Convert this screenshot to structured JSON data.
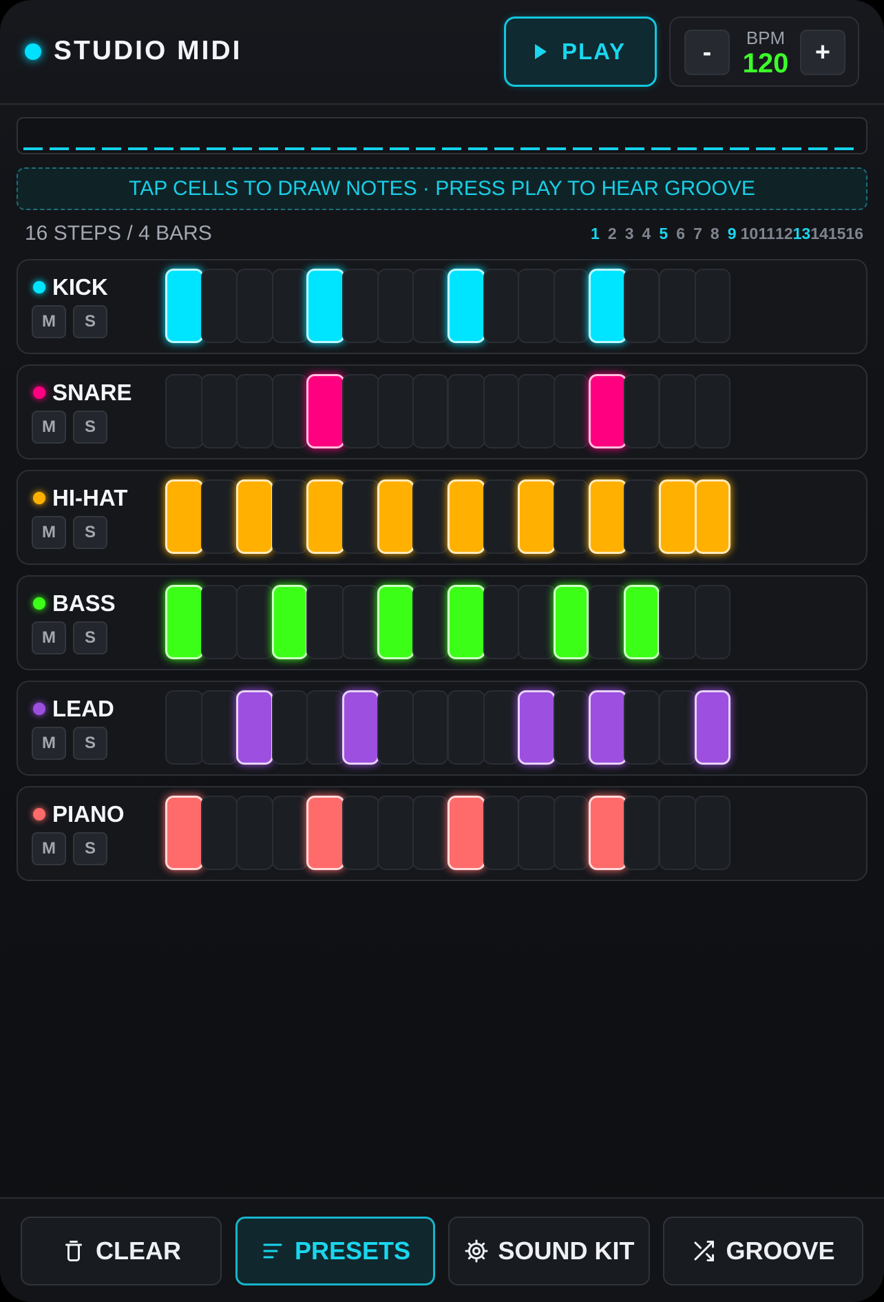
{
  "header": {
    "title": "STUDIO MIDI",
    "play_label": "PLAY",
    "bpm_label": "BPM",
    "bpm_value": "120",
    "bpm_minus": "-",
    "bpm_plus": "+"
  },
  "hint": "TAP CELLS TO DRAW NOTES · PRESS PLAY TO HEAR GROOVE",
  "steps_label": "16 STEPS / 4 BARS",
  "step_numbers": [
    "1",
    "2",
    "3",
    "4",
    "5",
    "6",
    "7",
    "8",
    "9",
    "10",
    "11",
    "12",
    "13",
    "14",
    "15",
    "16"
  ],
  "highlighted_steps": [
    1,
    5,
    9,
    13
  ],
  "mute_label": "M",
  "solo_label": "S",
  "tracks": [
    {
      "name": "KICK",
      "color": "#00e5ff",
      "pattern": [
        1,
        0,
        0,
        0,
        1,
        0,
        0,
        0,
        1,
        0,
        0,
        0,
        1,
        0,
        0,
        0
      ]
    },
    {
      "name": "SNARE",
      "color": "#ff0080",
      "pattern": [
        0,
        0,
        0,
        0,
        1,
        0,
        0,
        0,
        0,
        0,
        0,
        0,
        1,
        0,
        0,
        0
      ]
    },
    {
      "name": "HI-HAT",
      "color": "#ffb000",
      "pattern": [
        1,
        0,
        1,
        0,
        1,
        0,
        1,
        0,
        1,
        0,
        1,
        0,
        1,
        0,
        1,
        1
      ]
    },
    {
      "name": "BASS",
      "color": "#3cff18",
      "pattern": [
        1,
        0,
        0,
        1,
        0,
        0,
        1,
        0,
        1,
        0,
        0,
        1,
        0,
        1,
        0,
        0
      ]
    },
    {
      "name": "LEAD",
      "color": "#9d4fe0",
      "pattern": [
        0,
        0,
        1,
        0,
        0,
        1,
        0,
        0,
        0,
        0,
        1,
        0,
        1,
        0,
        0,
        1
      ]
    },
    {
      "name": "PIANO",
      "color": "#ff6b6b",
      "pattern": [
        1,
        0,
        0,
        0,
        1,
        0,
        0,
        0,
        1,
        0,
        0,
        0,
        1,
        0,
        0,
        0
      ]
    }
  ],
  "bottom_bar": {
    "clear": "CLEAR",
    "presets": "PRESETS",
    "sound_kit": "SOUND KIT",
    "groove": "GROOVE"
  },
  "colors": {
    "accent": "#1ad6ee",
    "bpm": "#3cff2a"
  }
}
